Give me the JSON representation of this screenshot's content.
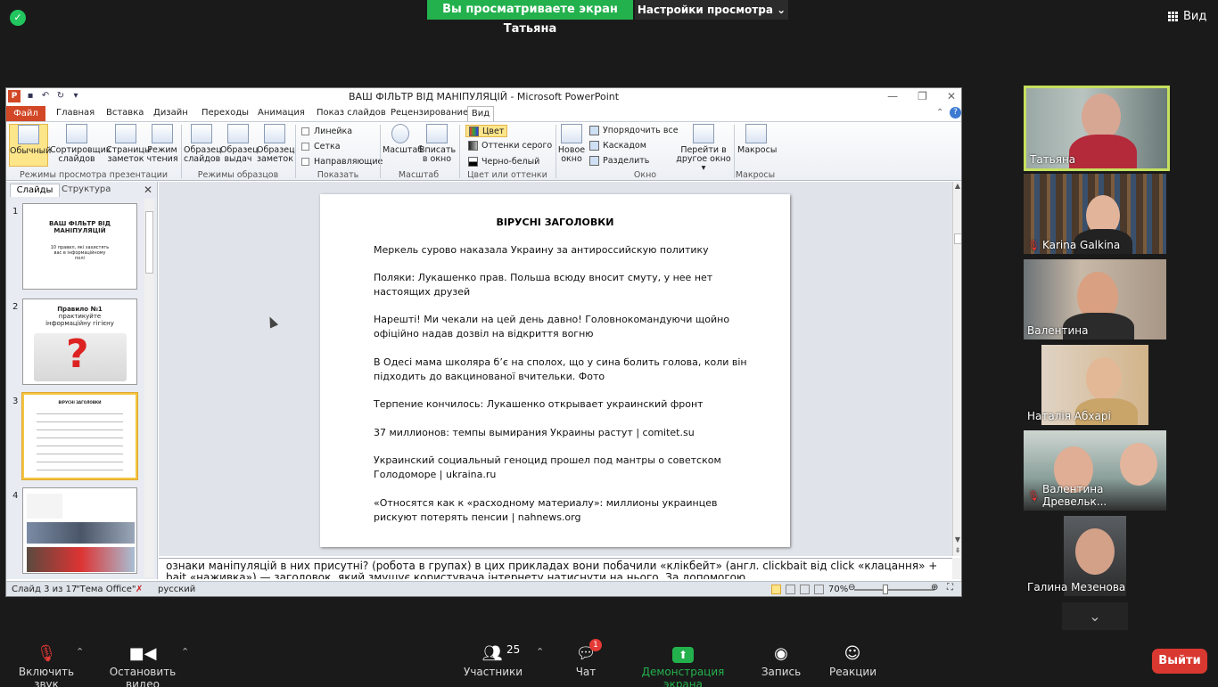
{
  "zoom": {
    "sharing_banner": "Вы просматриваете экран Татьяна",
    "view_options": "Настройки просмотра",
    "view_button": "Вид"
  },
  "ppt": {
    "window_title": "ВАШ ФІЛЬТР ВІД МАНІПУЛЯЦІЙ  -  Microsoft PowerPoint",
    "tabs": [
      "Файл",
      "Главная",
      "Вставка",
      "Дизайн",
      "Переходы",
      "Анимация",
      "Показ слайдов",
      "Рецензирование",
      "Вид"
    ],
    "ribbon": {
      "normal": "Обычный",
      "sorter": [
        "Сортировщик",
        "слайдов"
      ],
      "notes_page": [
        "Страницы",
        "заметок"
      ],
      "reading": [
        "Режим",
        "чтения"
      ],
      "slide_master": [
        "Образец",
        "слайдов"
      ],
      "handout_master": [
        "Образец",
        "выдач"
      ],
      "notes_master": [
        "Образец",
        "заметок"
      ],
      "ruler": "Линейка",
      "grid": "Сетка",
      "guides": "Направляющие",
      "zoom": "Масштаб",
      "fit": [
        "Вписать",
        "в окно"
      ],
      "color": "Цвет",
      "grayscale": "Оттенки серого",
      "bw": "Черно-белый",
      "new_window": [
        "Новое",
        "окно"
      ],
      "arrange_all": "Упорядочить все",
      "cascade": "Каскадом",
      "split": "Разделить",
      "switch_windows": [
        "Перейти в",
        "другое окно"
      ],
      "macros": "Макросы",
      "groups": {
        "views": "Режимы просмотра презентации",
        "masters": "Режимы образцов",
        "show": "Показать",
        "zoom": "Масштаб",
        "color": "Цвет или оттенки серого",
        "window": "Окно",
        "macros": "Макросы"
      }
    },
    "left_tabs": [
      "Слайды",
      "Структура"
    ],
    "thumbs": {
      "n1": "1",
      "n2": "2",
      "n3": "3",
      "n4": "4",
      "t1_title": "ВАШ ФІЛЬТР ВІД МАНІПУЛЯЦІЙ",
      "t1_sub": "10 правил, які захистять вас в інформаційному полі",
      "t2_title": "Правило №1",
      "t2_sub": "практикуйте інформаційну гігієну",
      "t3_title": "ВІРУСНІ ЗАГОЛОВКИ"
    },
    "slide": {
      "title": "ВІРУСНІ ЗАГОЛОВКИ",
      "headlines": [
        "Меркель сурово наказала Украину за антироссийскую политику",
        "Поляки: Лукашенко прав. Польша всюду вносит смуту, у нее нет настоящих друзей",
        "Нарешті! Ми чекали на цей день давно! Головнокомандуючи щойно офіційно надав дозвіл на відкриття вогню",
        "В Одесі мама школяра б’є на сполох, що у сина болить голова, коли він підходить до вакцинованої вчительки. Фото",
        "Терпение  кончилось: Лукашенко открывает украинский фронт",
        "37 миллионов: темпы вымирания Украины растут | comitet.su",
        "Украинский социальный геноцид прошел под мантры о советском Голодоморе | ukraina.ru",
        "«Относятся как к «расходному материалу»: миллионы украинцев рискуют потерять пенсии | nahnews.org"
      ]
    },
    "notes_text": "ознаки маніпуляцій в них присутні? (робота в групах) в цих прикладах вони побачили «клікбейт» (англ. clickbait від click «клацання» + bait «наживка») — заголовок, який змушує користувача інтернету натиснути на нього. За допомогою",
    "status": {
      "slide_of": "Слайд 3 из 17",
      "theme": "\"Тема Office\"",
      "lang": "русский",
      "zoom": "70%"
    }
  },
  "participants": [
    {
      "name": "Татьяна",
      "muted": false
    },
    {
      "name": "Karina Galkina",
      "muted": true
    },
    {
      "name": "Валентина",
      "muted": false
    },
    {
      "name": "Наталія Абхарі",
      "muted": false
    },
    {
      "name": "Валентина Древельк...",
      "muted": true
    },
    {
      "name": "Галина Мезенова",
      "muted": false
    }
  ],
  "toolbar": {
    "unmute": "Включить звук",
    "stop_video": "Остановить видео",
    "participants": "Участники",
    "participants_count": "25",
    "chat": "Чат",
    "chat_badge": "1",
    "share": "Демонстрация экрана",
    "record": "Запись",
    "reactions": "Реакции",
    "leave": "Выйти"
  }
}
